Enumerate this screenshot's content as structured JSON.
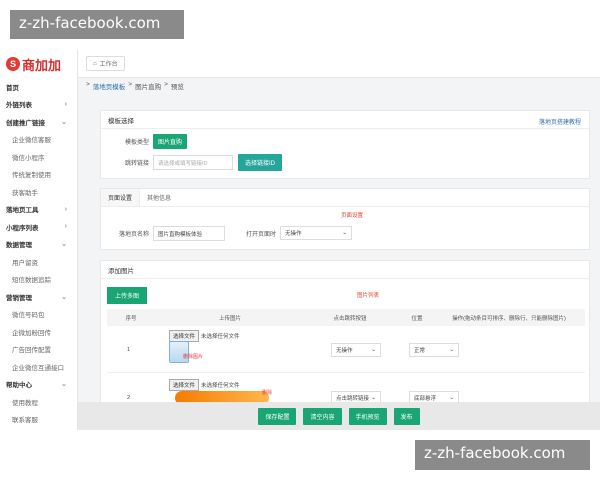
{
  "watermark": {
    "text": "z-zh-facebook.com"
  },
  "brand": {
    "mark": "S",
    "name": "商加加"
  },
  "sidebar": {
    "items": [
      {
        "label": "首页",
        "type": "group"
      },
      {
        "label": "外链列表",
        "type": "group",
        "chevron": "›"
      },
      {
        "label": "创建推广链接",
        "type": "group",
        "chevron": "⌄"
      },
      {
        "label": "企业微信客服",
        "type": "sub"
      },
      {
        "label": "微信小程序",
        "type": "sub"
      },
      {
        "label": "传统复制使用",
        "type": "sub"
      },
      {
        "label": "获客助手",
        "type": "sub"
      },
      {
        "label": "落地页工具",
        "type": "group",
        "chevron": "›"
      },
      {
        "label": "小程序列表",
        "type": "group",
        "chevron": "›"
      },
      {
        "label": "数据管理",
        "type": "group",
        "chevron": "⌄"
      },
      {
        "label": "用户留资",
        "type": "sub"
      },
      {
        "label": "短信数据追踪",
        "type": "sub"
      },
      {
        "label": "营销管理",
        "type": "group",
        "chevron": "⌄"
      },
      {
        "label": "微信号码包",
        "type": "sub"
      },
      {
        "label": "企微加粉回传",
        "type": "sub"
      },
      {
        "label": "广告回传配置",
        "type": "sub"
      },
      {
        "label": "企业微信互通接口",
        "type": "sub"
      },
      {
        "label": "帮助中心",
        "type": "group",
        "chevron": "⌄"
      },
      {
        "label": "使用教程",
        "type": "sub"
      },
      {
        "label": "联系客服",
        "type": "sub"
      }
    ]
  },
  "topbar": {
    "tab_label": "工作台",
    "home_icon": "home-icon"
  },
  "breadcrumb": {
    "items": [
      "落地页模板",
      "图片直购",
      "预览"
    ],
    "separator": ">"
  },
  "panel1": {
    "title": "模板选择",
    "help_link": "落地页搭建教程",
    "type_label": "模板类型",
    "type_value": "图片直购",
    "link_label": "跳转链接",
    "link_placeholder": "请选择或填写链接ID",
    "select_button": "选择链接ID"
  },
  "panel2": {
    "tabs": [
      "页面设置",
      "其他信息"
    ],
    "note": "页面设置",
    "name_label": "落地页名称",
    "name_value": "图片直购模板体验",
    "open_label": "打开页面时",
    "open_value": "无操作"
  },
  "panel3": {
    "title": "添加图片",
    "upload_button": "上传多图",
    "note": "图片列表",
    "columns": [
      "序号",
      "上传图片",
      "点击跳转按钮",
      "位置",
      "操作(拖动条目可排序、删除行、只能删除图片)"
    ],
    "rows": [
      {
        "index": "1",
        "file_button": "选择文件",
        "file_status": "未选择任何文件",
        "delete": "删除图片",
        "action": "无操作",
        "position": "正常"
      },
      {
        "index": "2",
        "file_button": "选择文件",
        "file_status": "未选择任何文件",
        "delete": "删除",
        "action": "点击跳转链接",
        "position": "底部悬浮"
      }
    ]
  },
  "bottom_buttons": [
    "保存配置",
    "清空内容",
    "手机预览",
    "发布"
  ],
  "colors": {
    "primary": "#1aa574",
    "brand_red": "#d32f2f",
    "link": "#2e6fb0",
    "warn": "#e53935"
  }
}
